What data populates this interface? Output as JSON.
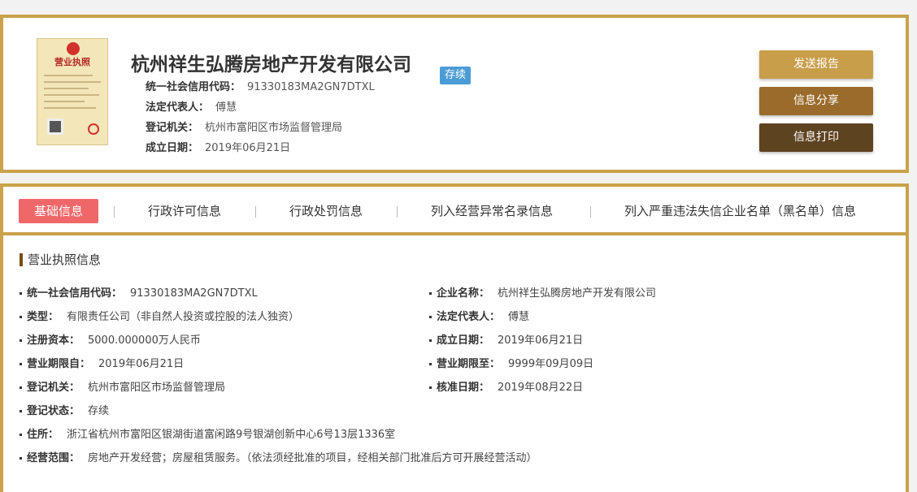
{
  "company": {
    "name": "杭州祥生弘腾房地产开发有限公司",
    "status": "存续",
    "license_title": "营业执照",
    "summary": [
      {
        "label": "统一社会信用代码：",
        "value": "91330183MA2GN7DTXL"
      },
      {
        "label": "法定代表人：",
        "value": "傅慧"
      },
      {
        "label": "登记机关：",
        "value": "杭州市富阳区市场监督管理局"
      },
      {
        "label": "成立日期：",
        "value": "2019年06月21日"
      }
    ]
  },
  "actions": {
    "send": "发送报告",
    "share": "信息分享",
    "print": "信息打印"
  },
  "tabs": [
    {
      "label": "基础信息",
      "active": true
    },
    {
      "label": "行政许可信息",
      "active": false
    },
    {
      "label": "行政处罚信息",
      "active": false
    },
    {
      "label": "列入经营异常名录信息",
      "active": false
    },
    {
      "label": "列入严重违法失信企业名单（黑名单）信息",
      "active": false
    }
  ],
  "section": {
    "title": "营业执照信息",
    "left": [
      {
        "label": "统一社会信用代码：",
        "value": "91330183MA2GN7DTXL"
      },
      {
        "label": "类型：",
        "value": "有限责任公司（非自然人投资或控股的法人独资）"
      },
      {
        "label": "注册资本：",
        "value": "5000.000000万人民币"
      },
      {
        "label": "营业期限自：",
        "value": "2019年06月21日"
      },
      {
        "label": "登记机关：",
        "value": "杭州市富阳区市场监督管理局"
      },
      {
        "label": "登记状态：",
        "value": "存续"
      },
      {
        "label": "住所：",
        "value": "浙江省杭州市富阳区银湖街道富闲路9号银湖创新中心6号13层1336室"
      },
      {
        "label": "经营范围：",
        "value": "房地产开发经营；房屋租赁服务。（依法须经批准的项目，经相关部门批准后方可开展经营活动）"
      }
    ],
    "right": [
      {
        "label": "企业名称：",
        "value": "杭州祥生弘腾房地产开发有限公司"
      },
      {
        "label": "法定代表人：",
        "value": "傅慧"
      },
      {
        "label": "成立日期：",
        "value": "2019年06月21日"
      },
      {
        "label": "营业期限至：",
        "value": "9999年09月09日"
      },
      {
        "label": "核准日期：",
        "value": "2019年08月22日"
      }
    ]
  },
  "colors": {
    "border_gold": "#c9a24a",
    "tab_active": "#f0676a",
    "status_tag": "#4b9cd6",
    "btn_send": "#c89e4a",
    "btn_share": "#9a6b2b",
    "btn_print": "#5e4321"
  }
}
